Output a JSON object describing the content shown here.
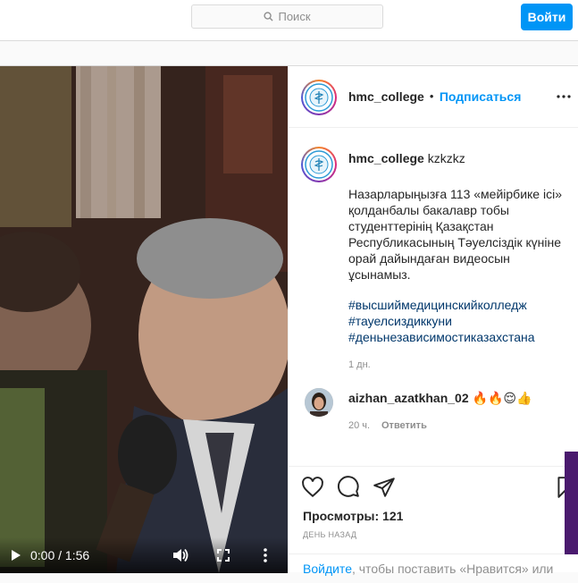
{
  "search": {
    "placeholder": "Поиск"
  },
  "nav": {
    "login_label": "Войти"
  },
  "video": {
    "current_time": "0:00 / 1:56"
  },
  "header": {
    "username": "hmc_college",
    "separator": "•",
    "follow_label": "Подписаться",
    "more_icon": "more-horizontal-icon"
  },
  "caption": {
    "username": "hmc_college",
    "location_word": "kzkzkz",
    "text": "Назарларыңызға 113 «мейірбике ісі» қолданбалы бакалавр тобы студенттерінің Қазақстан Республикасының Тәуелсіздік күніне орай дайындаған видеосын ұсынамыз.",
    "hashtags": [
      "#высшиймедицинскийколледж",
      "#тауелсиздиккуни",
      "#деньнезависимостиказахстана"
    ],
    "time": "1 дн."
  },
  "comment": {
    "username": "aizhan_azatkhan_02",
    "emoji": "🔥🔥😌👍",
    "time": "20 ч.",
    "reply_label": "Ответить"
  },
  "actions": {
    "views": "Просмотры: 121",
    "ago": "ДЕНЬ НАЗАД",
    "login_link": "Войдите",
    "login_text": ", чтобы поставить «Нравится» или"
  },
  "colors": {
    "accent": "#0095f6",
    "hashtag": "#00376b",
    "muted": "#8e8e8e"
  }
}
